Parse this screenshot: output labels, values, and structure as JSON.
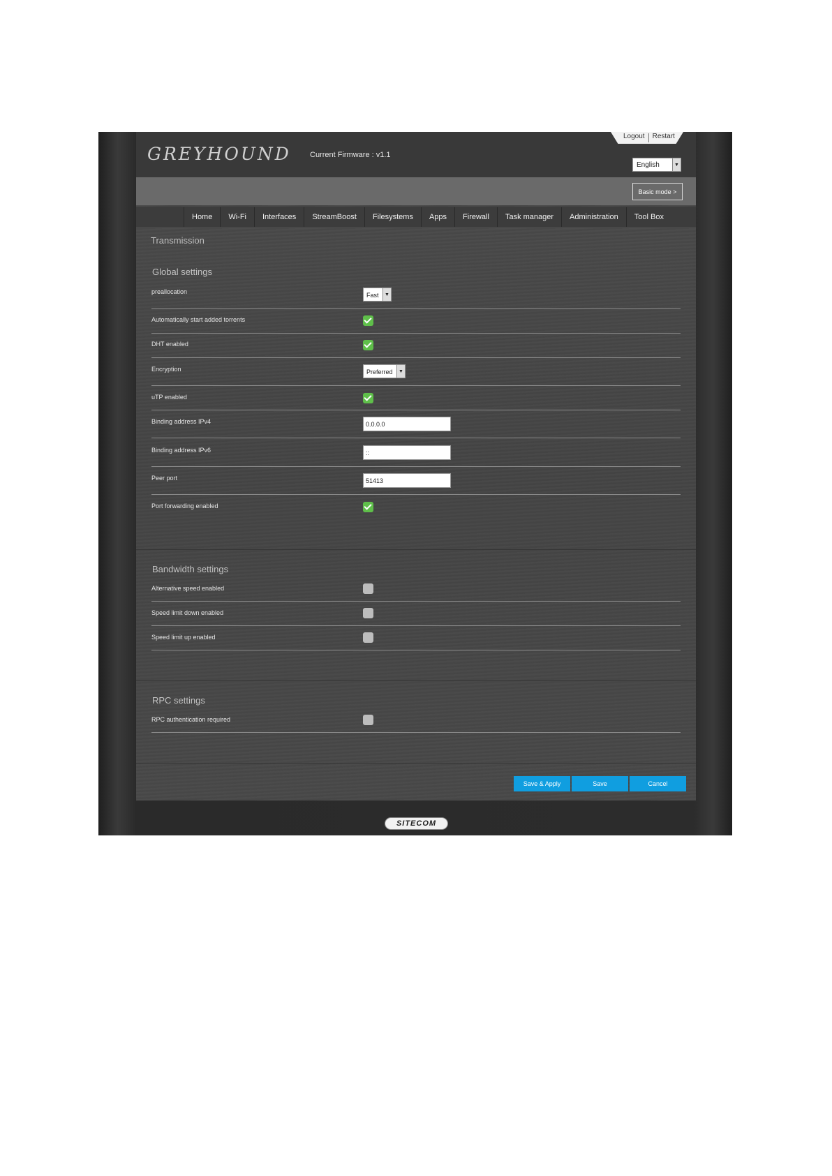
{
  "header": {
    "brand": "GREYHOUND",
    "firmware": "Current Firmware : v1.1",
    "logout": "Logout",
    "restart": "Restart",
    "language": "English",
    "basic_mode": "Basic mode >"
  },
  "nav": [
    "Home",
    "Wi-Fi",
    "Interfaces",
    "StreamBoost",
    "Filesystems",
    "Apps",
    "Firewall",
    "Task manager",
    "Administration",
    "Tool Box"
  ],
  "page_title": "Transmission",
  "global": {
    "title": "Global settings",
    "preallocation_label": "preallocation",
    "preallocation_value": "Fast",
    "auto_start_label": "Automatically start added torrents",
    "auto_start": true,
    "dht_label": "DHT enabled",
    "dht": true,
    "encryption_label": "Encryption",
    "encryption_value": "Preferred",
    "utp_label": "uTP enabled",
    "utp": true,
    "ipv4_label": "Binding address IPv4",
    "ipv4_value": "0.0.0.0",
    "ipv6_label": "Binding address IPv6",
    "ipv6_value": "::",
    "peer_port_label": "Peer port",
    "peer_port_value": "51413",
    "port_fwd_label": "Port forwarding enabled",
    "port_fwd": true
  },
  "bandwidth": {
    "title": "Bandwidth settings",
    "alt_speed_label": "Alternative speed enabled",
    "alt_speed": false,
    "down_label": "Speed limit down enabled",
    "down": false,
    "up_label": "Speed limit up enabled",
    "up": false
  },
  "rpc": {
    "title": "RPC settings",
    "auth_label": "RPC authentication required",
    "auth": false
  },
  "buttons": {
    "save_apply": "Save & Apply",
    "save": "Save",
    "cancel": "Cancel"
  },
  "footer_logo": "SITECOM",
  "colors": {
    "accent": "#109ee0",
    "check_on": "#5fbf4a",
    "check_off": "#bdbdbd"
  }
}
